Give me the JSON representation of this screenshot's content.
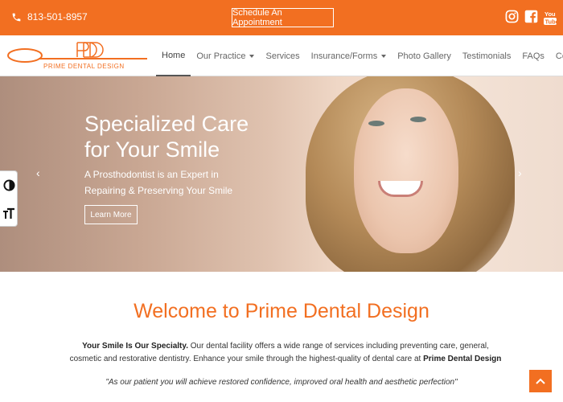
{
  "topbar": {
    "phone": "813-501-8957",
    "appointment_label": "Schedule An Appointment",
    "social": [
      "instagram-icon",
      "facebook-icon",
      "youtube-icon"
    ]
  },
  "brand": {
    "monogram": "PDD",
    "logo_text": "PRIME DENTAL DESIGN",
    "accent_color": "#f26f21"
  },
  "nav": {
    "items": [
      {
        "label": "Home",
        "active": true
      },
      {
        "label": "Our Practice",
        "dropdown": true
      },
      {
        "label": "Services"
      },
      {
        "label": "Insurance/Forms",
        "dropdown": true
      },
      {
        "label": "Photo Gallery"
      },
      {
        "label": "Testimonials"
      },
      {
        "label": "FAQs"
      },
      {
        "label": "Contact"
      }
    ]
  },
  "hero": {
    "title_line1": "Specialized Care",
    "title_line2": "for Your Smile",
    "subtitle_line1": "A Prosthodontist is an Expert in",
    "subtitle_line2": "Repairing & Preserving Your Smile",
    "cta_label": "Learn More",
    "prev": "‹",
    "next": "›"
  },
  "welcome": {
    "heading": "Welcome to Prime Dental Design",
    "intro_bold": "Your Smile Is Our Specialty.",
    "intro_text": " Our dental facility offers a wide range of services including preventing care, general, cosmetic and restorative dentistry. Enhance your smile through the highest-quality of dental care at ",
    "intro_brand": "Prime Dental Design",
    "quote": "\"As our patient you will achieve restored confidence, improved oral health and aesthetic perfection\""
  }
}
